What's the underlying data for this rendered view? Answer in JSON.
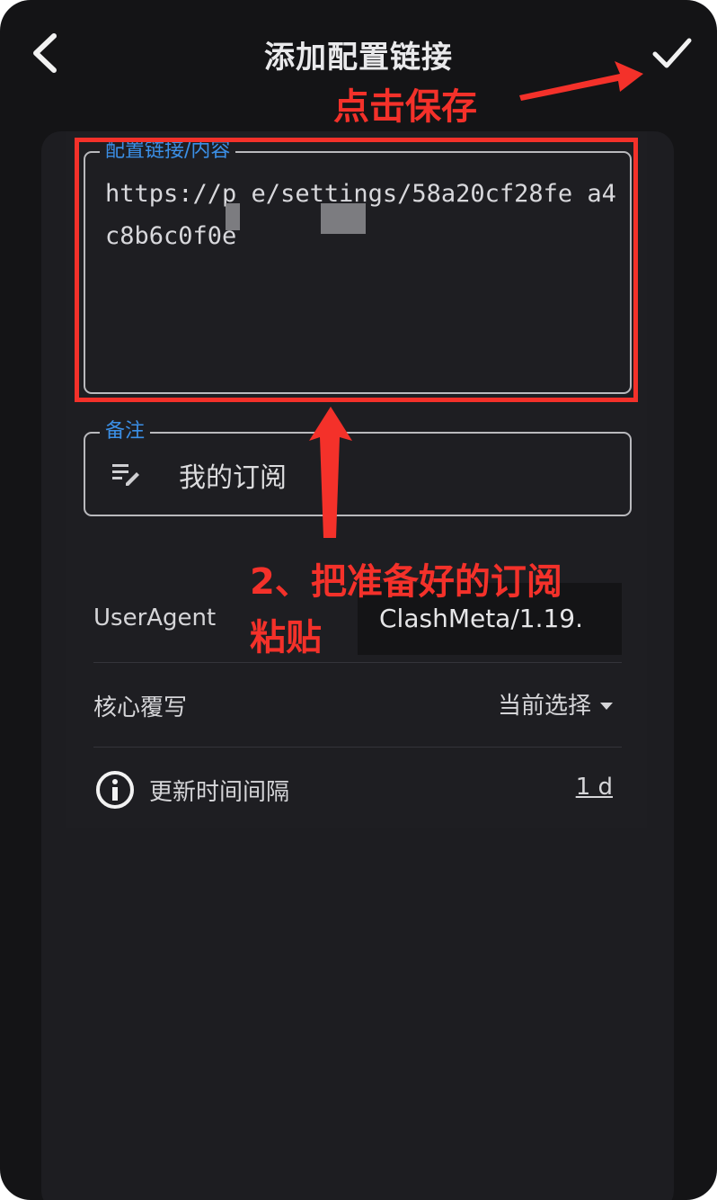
{
  "header": {
    "title": "添加配置链接"
  },
  "form": {
    "url_field": {
      "label": "配置链接/内容",
      "value": "https://p          e/settings/58a20cf28fe         a4c8b6c0f0e"
    },
    "remark_field": {
      "label": "备注",
      "value": "我的订阅"
    },
    "useragent": {
      "label": "UserAgent",
      "value": "ClashMeta/1.19."
    },
    "core_override": {
      "label": "核心覆写",
      "value": "当前选择"
    },
    "update_interval": {
      "label": "更新时间间隔",
      "value": "1 d"
    }
  },
  "annotations": {
    "save_hint": "点击保存",
    "paste_hint_line1": "2、把准备好的订阅",
    "paste_hint_line2": "粘贴",
    "color": "#f4312a"
  },
  "icons": [
    "back-arrow-icon",
    "checkmark-icon",
    "notes-edit-icon",
    "info-icon"
  ],
  "colors": {
    "background": "#141416",
    "sheet": "#1d1d21",
    "label_accent": "#3b8fe6",
    "annotation": "#f4312a"
  }
}
